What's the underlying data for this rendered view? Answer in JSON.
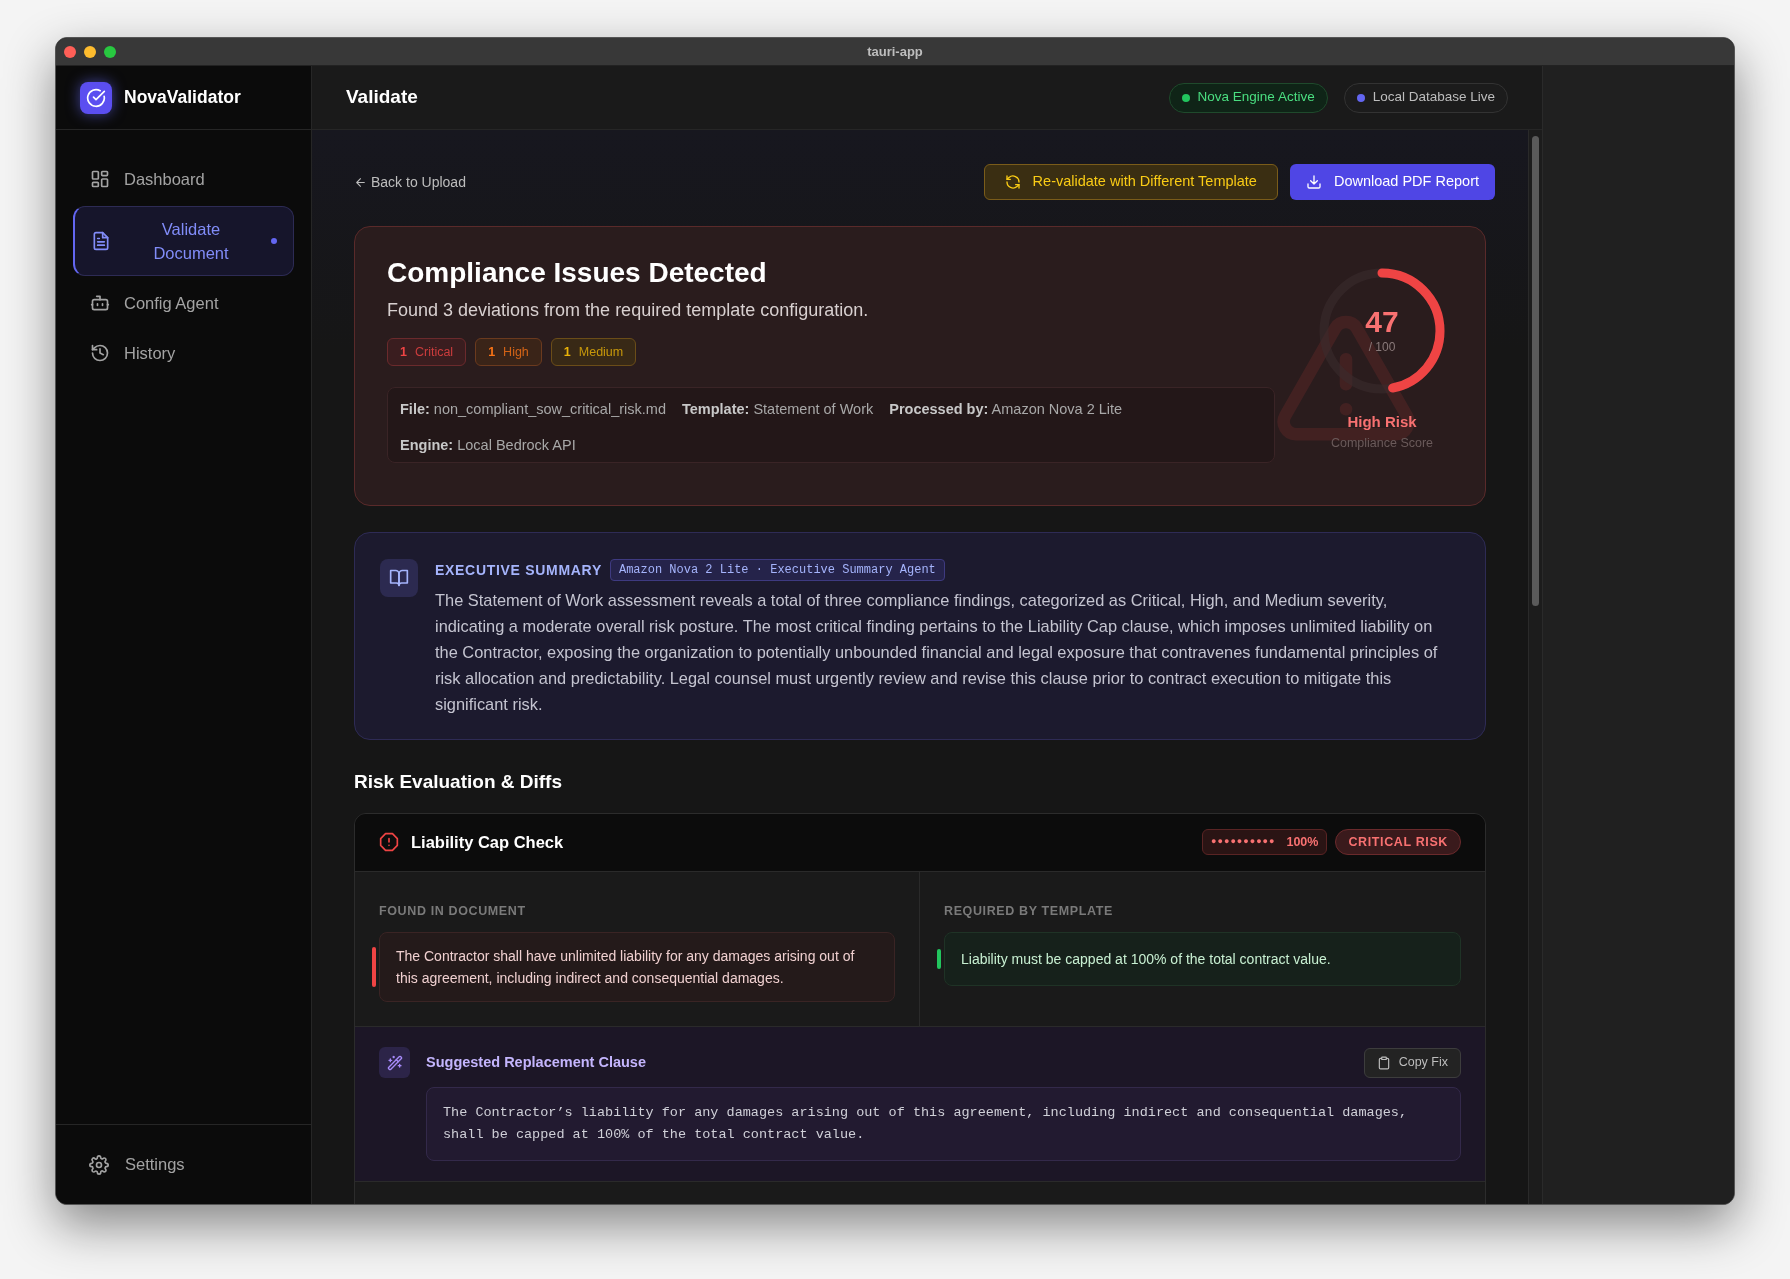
{
  "window": {
    "title": "tauri-app"
  },
  "sidebar": {
    "app_name": "NovaValidator",
    "items": [
      {
        "label": "Dashboard",
        "selected": false
      },
      {
        "label": "Validate Document",
        "selected": true
      },
      {
        "label": "Config Agent",
        "selected": false
      },
      {
        "label": "History",
        "selected": false
      }
    ],
    "settings": "Settings"
  },
  "header": {
    "title": "Validate",
    "statuses": [
      {
        "label": "Nova Engine Active",
        "color": "#22c55e"
      },
      {
        "label": "Local Database Live",
        "color": "#6366f1"
      }
    ]
  },
  "toolbar": {
    "back": "Back to Upload",
    "revalidate": "Re-validate with Different Template",
    "download": "Download PDF Report"
  },
  "result": {
    "title": "Compliance Issues Detected",
    "subtitle": "Found 3 deviations from the required template configuration.",
    "counts": [
      {
        "count": "1",
        "label": "Critical",
        "color": "#ef4444"
      },
      {
        "count": "1",
        "label": "High",
        "color": "#f97316"
      },
      {
        "count": "1",
        "label": "Medium",
        "color": "#eab308"
      }
    ],
    "meta": [
      {
        "key": "File:",
        "value": "non_compliant_sow_critical_risk.md"
      },
      {
        "key": "Template:",
        "value": "Statement of Work"
      },
      {
        "key": "Processed by:",
        "value": "Amazon Nova 2 Lite"
      },
      {
        "key": "Engine:",
        "value": "Local Bedrock API"
      }
    ],
    "score": {
      "value": "47",
      "max": "/ 100",
      "level": 0.47,
      "risk": "High Risk",
      "caption": "Compliance Score"
    }
  },
  "summary": {
    "heading": "EXECUTIVE SUMMARY",
    "agent": "Amazon Nova 2 Lite · Executive Summary Agent",
    "text": "The Statement of Work assessment reveals a total of three compliance findings, categorized as Critical, High, and Medium severity, indicating a moderate overall risk posture. The most critical finding pertains to the Liability Cap clause, which imposes unlimited liability on the Contractor, exposing the organization to potentially unbounded financial and legal exposure that contravenes fundamental principles of risk allocation and predictability. Legal counsel must urgently review and revise this clause prior to contract execution to mitigate this significant risk."
  },
  "risk_section": {
    "title": "Risk Evaluation & Diffs",
    "checks": [
      {
        "title": "Liability Cap Check",
        "confidence": {
          "dots": "●●●●●●●●●●",
          "label": "100%"
        },
        "severity": "CRITICAL RISK",
        "found_label": "FOUND IN DOCUMENT",
        "found_text": "The Contractor shall have unlimited liability for any damages arising out of this agreement, including indirect and consequential damages.",
        "required_label": "REQUIRED BY TEMPLATE",
        "required_text": "Liability must be capped at 100% of the total contract value.",
        "suggestion": {
          "title": "Suggested Replacement Clause",
          "copy": "Copy Fix",
          "text": "The Contractor’s liability for any damages arising out of this agreement, including indirect and consequential damages, shall be capped at 100% of the total contract value."
        }
      }
    ]
  }
}
